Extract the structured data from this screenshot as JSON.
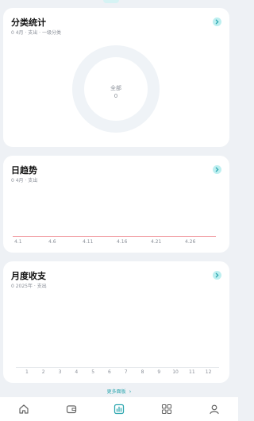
{
  "categories": {
    "title": "分类统计",
    "subtitle": "0 4月 · 支出 · 一级分类",
    "center_label": "全部",
    "center_value": "0"
  },
  "daily": {
    "title": "日趋势",
    "subtitle": "0 4月 · 支出"
  },
  "monthly": {
    "title": "月度收支",
    "subtitle": "0 2025年 · 支出"
  },
  "more_link": "更多面板",
  "nav": [
    "home-icon",
    "wallet-icon",
    "chart-icon",
    "grid-icon",
    "user-icon"
  ],
  "colors": {
    "accent": "#2ea7b0",
    "trend_line": "#ef8f95",
    "chip": "#bdeff0"
  },
  "chart_data": [
    {
      "type": "line",
      "title": "日趋势",
      "x": [
        "4.1",
        "4.6",
        "4.11",
        "4.16",
        "4.21",
        "4.26"
      ],
      "series": [
        {
          "values": [
            0,
            0,
            0,
            0,
            0,
            0
          ]
        }
      ]
    },
    {
      "type": "bar",
      "title": "月度收支",
      "categories": [
        "1",
        "2",
        "3",
        "4",
        "5",
        "6",
        "7",
        "8",
        "9",
        "10",
        "11",
        "12"
      ],
      "values": [
        0,
        0,
        0,
        0,
        0,
        0,
        0,
        0,
        0,
        0,
        0,
        0
      ]
    }
  ]
}
